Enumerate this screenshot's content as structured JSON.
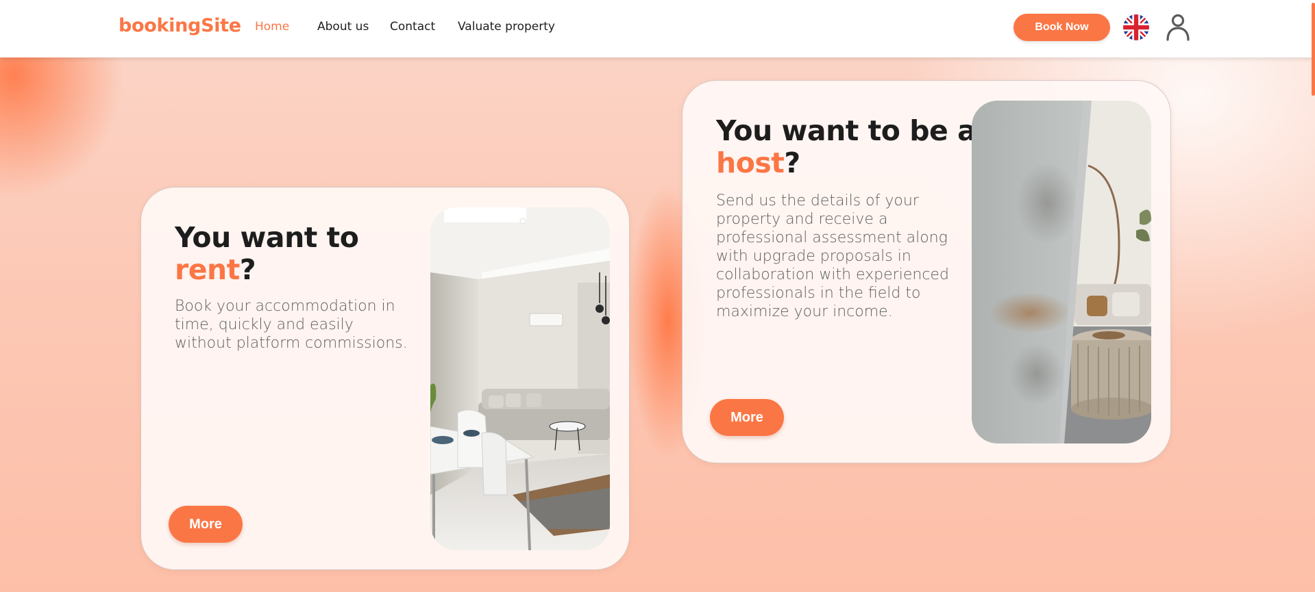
{
  "header": {
    "logo": "bookingSite",
    "nav": [
      {
        "label": "Home",
        "active": true
      },
      {
        "label": "About us",
        "active": false
      },
      {
        "label": "Contact",
        "active": false
      },
      {
        "label": "Valuate property",
        "active": false
      }
    ],
    "book_button": "Book Now",
    "language_icon": "uk-flag-icon",
    "profile_icon": "user-icon"
  },
  "cards": {
    "rent": {
      "title_prefix": "You want to",
      "title_accent": "rent",
      "title_suffix": "?",
      "text": "Book your accommodation in time, quickly and easily without platform commissions.",
      "button": "More",
      "image": "living-room-photo"
    },
    "host": {
      "title_prefix": "You want to be a",
      "title_accent": "host",
      "title_suffix": "?",
      "text": "Send us the details of your property and receive a professional assessment along with upgrade proposals in collaboration with experienced professionals in the field to maximize your income.",
      "button": "More",
      "image": "interior-pouf-photo"
    }
  },
  "colors": {
    "accent": "#fb7645",
    "text_dark": "#1d1d1d",
    "text_body": "#5e5e5e",
    "background": "#fcc9b6"
  }
}
